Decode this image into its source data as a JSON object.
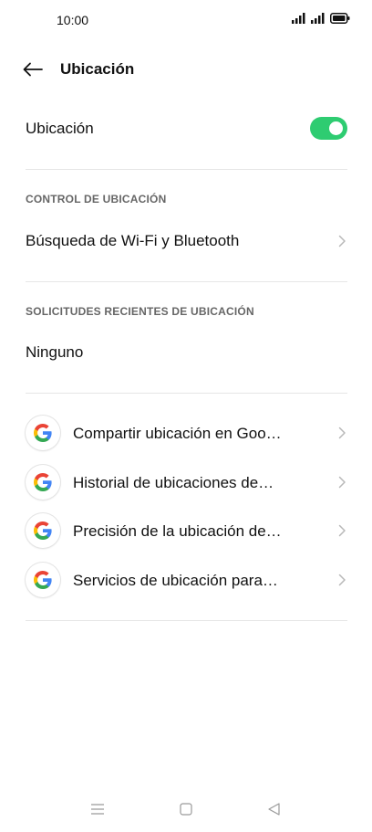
{
  "status_bar": {
    "time": "10:00"
  },
  "header": {
    "title": "Ubicación"
  },
  "location_toggle": {
    "label": "Ubicación",
    "state": "on",
    "color": "#2ecc71"
  },
  "section_control": {
    "header": "CONTROL DE UBICACIÓN",
    "items": [
      {
        "label": "Búsqueda de Wi-Fi y Bluetooth"
      }
    ]
  },
  "section_recent": {
    "header": "SOLICITUDES RECIENTES DE UBICACIÓN",
    "empty_text": "Ninguno"
  },
  "google_services": [
    {
      "label": "Compartir ubicación en Goo…",
      "icon": "google-icon"
    },
    {
      "label": "Historial de ubicaciones de…",
      "icon": "google-icon"
    },
    {
      "label": "Precisión de la ubicación de…",
      "icon": "google-icon"
    },
    {
      "label": "Servicios de ubicación para…",
      "icon": "google-icon"
    }
  ],
  "nav_bar": {
    "icons": [
      "menu-icon",
      "home-icon",
      "back-triangle-icon"
    ]
  }
}
